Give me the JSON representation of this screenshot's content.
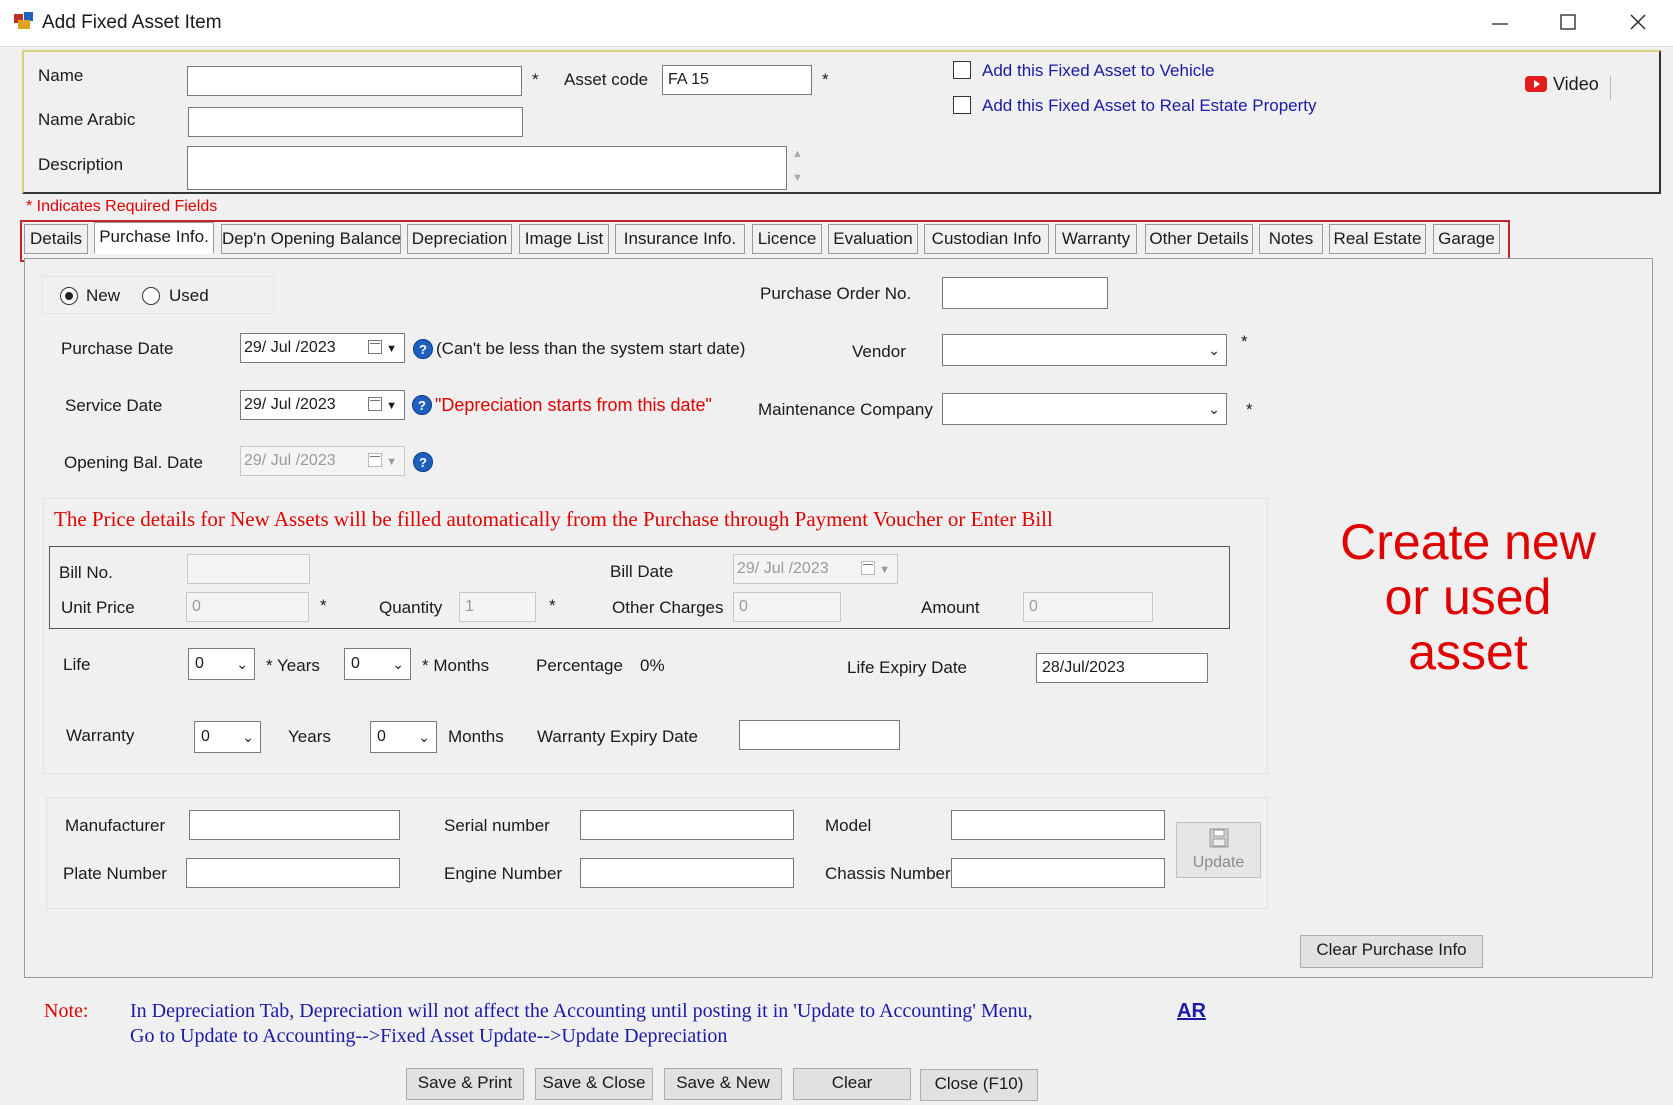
{
  "window": {
    "title": "Add Fixed Asset Item"
  },
  "header": {
    "name_label": "Name",
    "name_value": "",
    "name_arabic_label": "Name Arabic",
    "name_arabic_value": "",
    "description_label": "Description",
    "description_value": "",
    "asset_code_label": "Asset code",
    "asset_code_value": "FA 15",
    "required_star": "*",
    "vehicle_checkbox_label": "Add this Fixed Asset to Vehicle",
    "real_estate_checkbox_label": "Add this Fixed Asset to Real Estate Property",
    "video_label": "Video",
    "required_note": "* Indicates Required Fields"
  },
  "tabs": [
    "Details",
    "Purchase Info.",
    "Dep'n Opening Balance",
    "Depreciation",
    "Image List",
    "Insurance Info.",
    "Licence",
    "Evaluation",
    "Custodian Info",
    "Warranty",
    "Other Details",
    "Notes",
    "Real Estate",
    "Garage"
  ],
  "active_tab": "Purchase Info.",
  "purchase": {
    "radio_new": "New",
    "radio_used": "Used",
    "selected_condition": "New",
    "purchase_date_label": "Purchase Date",
    "purchase_date_value": "29/ Jul /2023",
    "purchase_date_hint": "(Can't be less than the system start date)",
    "service_date_label": "Service Date",
    "service_date_value": "29/ Jul /2023",
    "service_date_hint": "\"Depreciation starts from this date\"",
    "opening_bal_date_label": "Opening Bal. Date",
    "opening_bal_date_value": "29/ Jul /2023",
    "po_label": "Purchase Order No.",
    "po_value": "",
    "vendor_label": "Vendor",
    "vendor_value": "",
    "maintenance_label": "Maintenance Company",
    "maintenance_value": "",
    "price_notice": "The Price details for New Assets will be filled automatically from the Purchase through Payment Voucher or Enter Bill",
    "bill_no_label": "Bill No.",
    "bill_no_value": "",
    "bill_date_label": "Bill Date",
    "bill_date_value": "29/ Jul /2023",
    "unit_price_label": "Unit Price",
    "unit_price_value": "0",
    "quantity_label": "Quantity",
    "quantity_value": "1",
    "other_charges_label": "Other Charges",
    "other_charges_value": "0",
    "amount_label": "Amount",
    "amount_value": "0",
    "life_label": "Life",
    "life_years_value": "0",
    "life_months_value": "0",
    "years_label": "Years",
    "months_label": "Months",
    "star_years_label": "* Years",
    "star_months_label": "* Months",
    "percentage_label": "Percentage",
    "percentage_value": "0%",
    "life_expiry_label": "Life Expiry Date",
    "life_expiry_value": "28/Jul/2023",
    "warranty_label": "Warranty",
    "warranty_years_value": "0",
    "warranty_months_value": "0",
    "warranty_expiry_label": "Warranty Expiry Date",
    "warranty_expiry_value": "",
    "manufacturer_label": "Manufacturer",
    "serial_label": "Serial number",
    "model_label": "Model",
    "plate_label": "Plate Number",
    "engine_label": "Engine Number",
    "chassis_label": "Chassis Number",
    "update_label": "Update",
    "clear_purchase_label": "Clear Purchase Info"
  },
  "overlay": {
    "line1": "Create new",
    "line2": "or used",
    "line3": "asset"
  },
  "footer": {
    "note_label": "Note:",
    "note_line1": "In Depreciation Tab, Depreciation will not affect the Accounting until posting it in 'Update to Accounting' Menu,",
    "note_line2": "Go to Update to Accounting-->Fixed Asset Update-->Update Depreciation",
    "ar_link": "AR",
    "buttons": [
      "Save & Print",
      "Save & Close",
      "Save & New",
      "Clear",
      "Close (F10)"
    ]
  },
  "colors": {
    "accent_red": "#e00000",
    "link_blue": "#1a1aa6",
    "highlight_border": "#c0272d"
  }
}
